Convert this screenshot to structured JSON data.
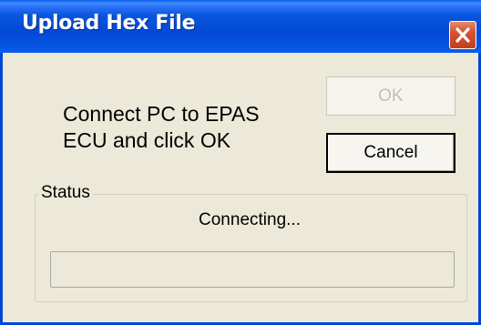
{
  "window": {
    "title": "Upload Hex File"
  },
  "dialog": {
    "prompt": "Connect PC to EPAS\nECU and click OK",
    "ok_label": "OK",
    "ok_enabled": false,
    "cancel_label": "Cancel"
  },
  "status": {
    "group_label": "Status",
    "message": "Connecting...",
    "progress_percent": 0
  },
  "icons": {
    "close": "close-icon"
  },
  "colors": {
    "titlebar": "#0349d6",
    "close_button": "#d6522f",
    "dialog_background": "#ece9d8",
    "disabled_text": "#c0bdae"
  }
}
